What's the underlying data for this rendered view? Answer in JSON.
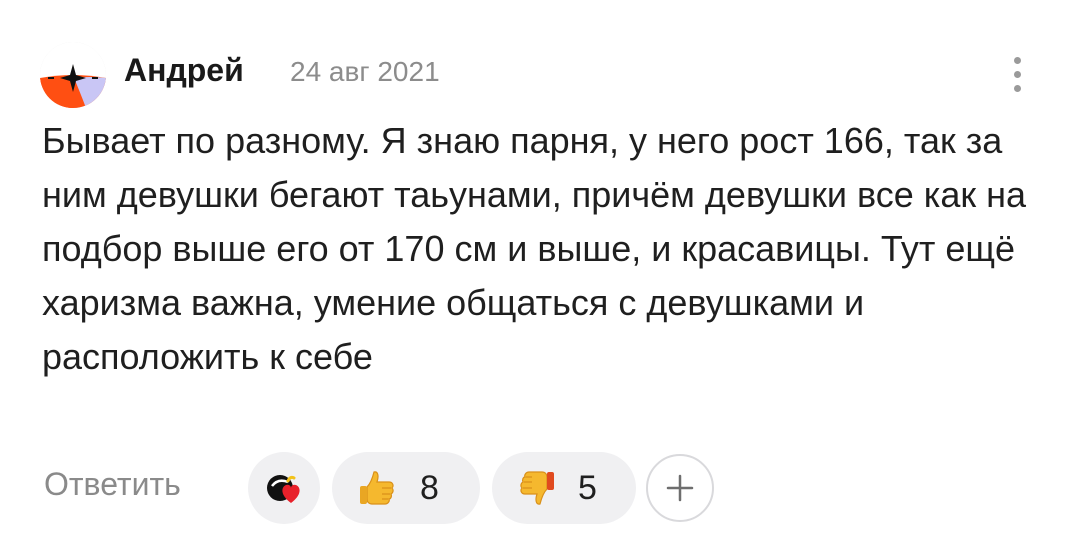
{
  "comment": {
    "author": "Андрей",
    "date": "24 авг 2021",
    "text": "Бывает по разному. Я знаю парня, у него рост 166, так за ним девушки бегают таьунами, причём девушки все как на подбор выше его от 170 см и выше, и красавицы. Тут ещё харизма важна, умение общаться с девушками и расположить к себе",
    "avatar_icon": "orange-star-avatar"
  },
  "actions": {
    "reply_label": "Ответить",
    "reaction_icon": "heart-reaction-icon",
    "like_icon": "thumbs-up-icon",
    "like_count": "8",
    "dislike_icon": "thumbs-down-icon",
    "dislike_count": "5",
    "add_icon": "plus-icon"
  },
  "colors": {
    "avatar_orange": "#ff4f12",
    "avatar_lavender": "#c9c6f5",
    "text": "#1f1f1f",
    "muted": "#8a8a8a",
    "pill_bg": "#f0f0f2"
  }
}
